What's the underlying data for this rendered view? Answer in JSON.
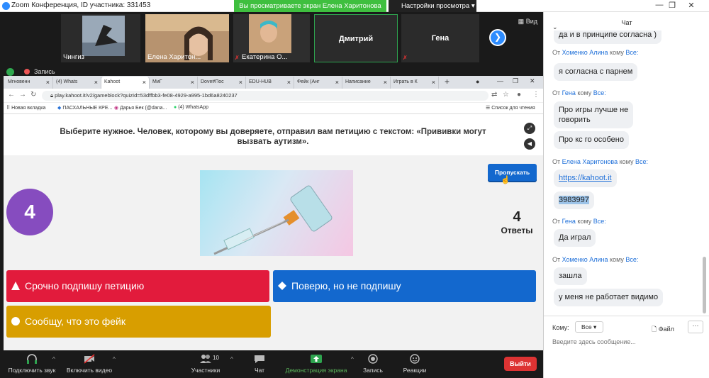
{
  "window": {
    "title": "Zoom Конференция, ID участника: 331453",
    "share_banner": "Вы просматриваете экран Елена Харитонова",
    "view_options": "Настройки просмотра"
  },
  "gallery": {
    "tiles": [
      {
        "name": "Чингиз"
      },
      {
        "name": "Елена Харитон..."
      },
      {
        "name": "Екатерина О..."
      },
      {
        "name": "Дмитрий"
      },
      {
        "name": "Гена"
      }
    ],
    "view_label": "Вид"
  },
  "recording": {
    "label": "Запись"
  },
  "browser": {
    "tabs": [
      "Мгновенн",
      "(4) Whats",
      "Kahoot",
      "МиГ",
      "Dove#Пос",
      "EDU-HUB",
      "Фейк (Анг",
      "Написание",
      "Играть в К"
    ],
    "url": "play.kahoot.it/v2/gameblock?quizId=53dffbb3-fe08-4929-a995-1bd6a8240237",
    "bookmarks": [
      "Новая вкладка",
      "ПАСХАЛЬНЫЕ КРЕ...",
      "Дарья Бек (@dana...",
      "(4) WhatsApp",
      "Список для чтения"
    ]
  },
  "kahoot": {
    "question": "Выберите нужное. Человек, которому вы доверяете, отправил вам петицию с текстом: «Прививки могут вызвать аутизм».",
    "timer": "4",
    "skip_label": "Пропускать",
    "answers_count": "4",
    "answers_label": "Ответы",
    "answers": [
      {
        "text": "Срочно подпишу петицию",
        "color": "#e21b3c",
        "icon": "triangle-icon"
      },
      {
        "text": "Поверю, но не подпишу",
        "color": "#1368ce",
        "icon": "diamond-icon"
      },
      {
        "text": "Сообщу, что это фейк",
        "color": "#d89e00",
        "icon": "circle-icon"
      }
    ]
  },
  "toolbar": {
    "audio": "Подключить звук",
    "video": "Включить видео",
    "participants": "Участники",
    "participants_count": "10",
    "chat": "Чат",
    "share": "Демонстрация экрана",
    "record": "Запись",
    "reactions": "Реакции",
    "exit": "Выйти"
  },
  "chat": {
    "title": "Чат",
    "partial_top": "да и в принципе согласна )",
    "msg1_from": "Хоменко Алина",
    "msg1_to": "Все:",
    "msg1_text": "я согласна с парнем",
    "msg2_from": "Гена",
    "msg2_to": "Все:",
    "msg2_text_a": "Про игры лучше не",
    "msg2_text_b": "говорить",
    "msg2_text_c": "Про кс го особено",
    "msg3_from": "Елена Харитонова",
    "msg3_to": "Все:",
    "msg3_text_a": "https://kahoot.it",
    "msg3_text_b": "3983997",
    "msg4_from": "Гена",
    "msg4_to": "Все:",
    "msg4_text": "Да играл",
    "msg5_from": "Хоменко Алина",
    "msg5_to": "Все:",
    "msg5_text_a": "зашла",
    "msg5_text_b": "у меня не работает видимо",
    "from_word": "От",
    "to_word": "кому",
    "to_label": "Кому:",
    "to_value": "Все",
    "file_label": "Файл",
    "more_label": "···",
    "input_placeholder": "Введите здесь сообщение..."
  }
}
